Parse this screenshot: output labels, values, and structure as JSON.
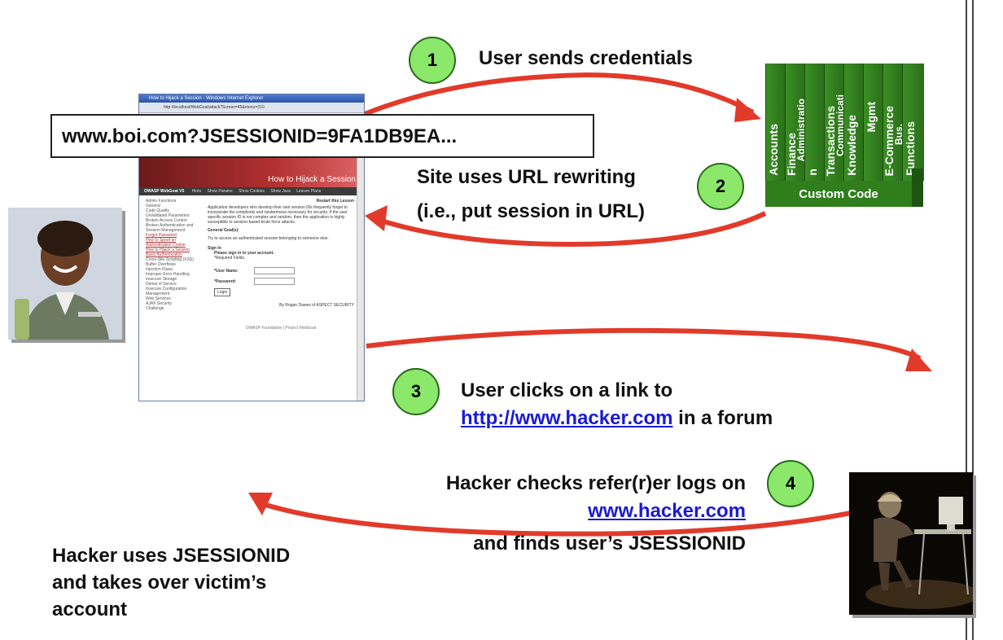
{
  "url_box": "www.boi.com?JSESSIONID=9FA1DB9EA...",
  "steps": [
    {
      "number": "1",
      "text": "User sends credentials"
    },
    {
      "number": "2",
      "line1": "Site uses URL rewriting",
      "line2": "(i.e., put session in URL)"
    },
    {
      "number": "3",
      "line1": "User clicks on a link to",
      "link": "http://www.hacker.com",
      "suffix": " in a forum"
    },
    {
      "number": "4",
      "line1": "Hacker checks refer(r)er logs on",
      "link": "www.hacker.com",
      "line3": "and finds user’s JSESSIONID"
    }
  ],
  "final_text": {
    "line1": "Hacker uses JSESSIONID",
    "line2": "and takes over victim’s",
    "line3": "account"
  },
  "custom_code": {
    "label": "Custom Code",
    "columns": [
      "Accounts",
      "Finance",
      "Administratio",
      "n",
      "Transactions",
      "Communicati",
      "Knowledge",
      "Mgmt",
      "E-Commerce",
      "Bus.",
      "Functions"
    ]
  },
  "browser": {
    "title": "How to Hijack a Session - Windows Internet Explorer",
    "address": "http://localhost/WebGoat/attack?Screen=45&menu=310",
    "banner": "How to Hijack a Session",
    "nav_brand": "OWASP WebGoat V5",
    "nav_items": [
      "Hints",
      "Show Params",
      "Show Cookies",
      "Show Java",
      "Lesson Plans"
    ],
    "side_menu": [
      "Admin Functions",
      "General",
      "Code Quality",
      "Unvalidated Parameters",
      "Broken Access Control",
      "Broken Authentication and Session Management",
      "Forgot Password",
      "How to Spoof an Authentication Cookie",
      "How to Hijack a Session",
      "Basic Authentication",
      "Cross-Site Scripting (XSS)",
      "Buffer Overflows",
      "Injection Flaws",
      "Improper Error Handling",
      "Insecure Storage",
      "Denial of Service",
      "Insecure Configuration Management",
      "Web Services",
      "AJAX Security",
      "Challenge"
    ],
    "restart": "Restart this Lesson",
    "intro": "Application developers who develop their own session IDs frequently forget to incorporate the complexity and randomness necessary for security. If the user specific session ID is not complex and random, then the application is highly susceptible to session-based brute force attacks.",
    "goal_heading": "General Goal(s):",
    "goal_text": "Try to access an authenticated session belonging to someone else.",
    "sign_in": "Sign In",
    "sign_in_prompt": "Please sign in to your account.",
    "required": "*Required Fields",
    "user_label": "*User Name:",
    "pass_label": "*Password:",
    "login_button": "Login",
    "byline": "By Rogan Dawes of ASPECT SECURITY",
    "footer": "OWASP Foundation | Project WebGoat"
  },
  "colors": {
    "arrow": "#e23a2a",
    "circle": "#8be86b",
    "green_block": "#2f7d1c",
    "link": "#1a1ad6"
  }
}
